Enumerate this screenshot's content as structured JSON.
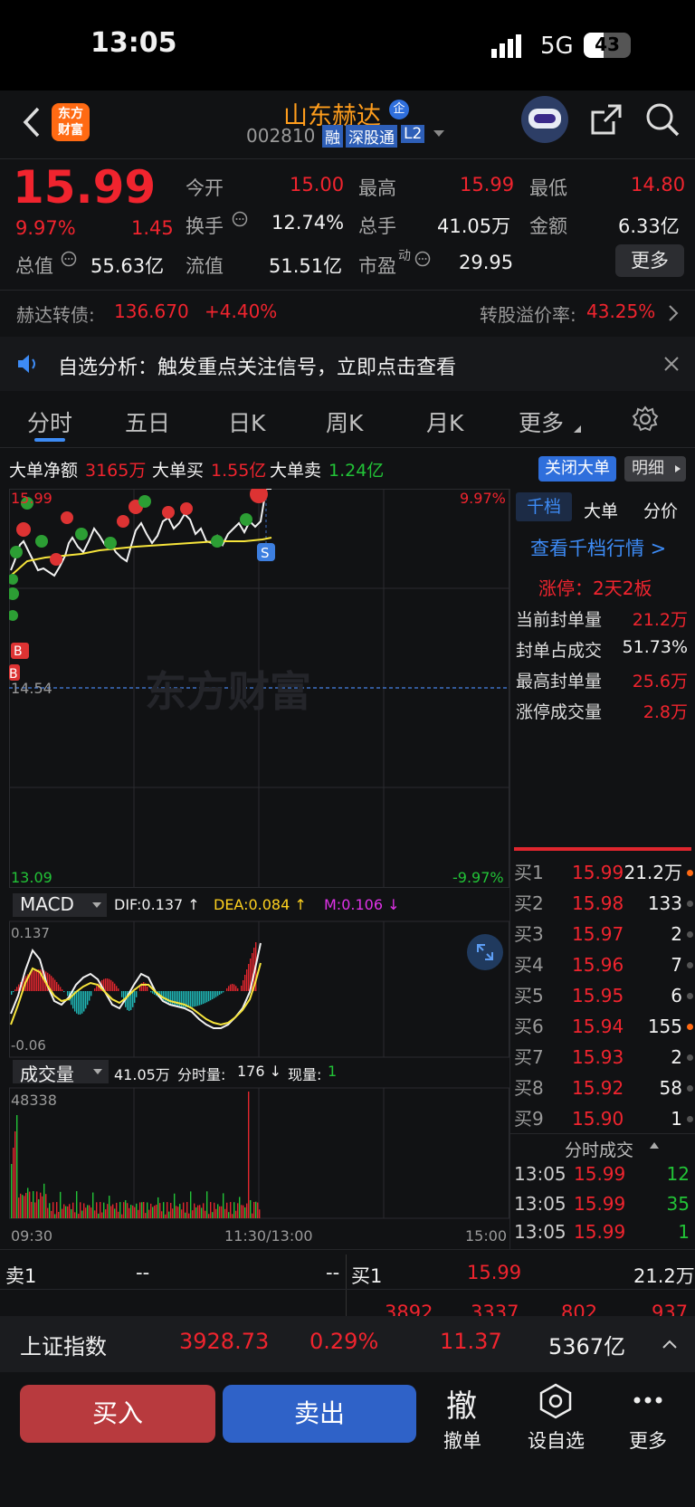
{
  "status_bar": {
    "time": "13:05",
    "network": "5G",
    "battery": "43"
  },
  "header": {
    "logo_text_1": "东方",
    "logo_text_2": "财富",
    "stock_name": "山东赫达",
    "stock_code": "002810",
    "tags": [
      "融",
      "深股通",
      "L2"
    ],
    "badge": "企"
  },
  "quote": {
    "price": "15.99",
    "change_pct": "9.97%",
    "change": "1.45",
    "total_mkt_label": "总值",
    "total_mkt": "55.63亿",
    "open_label": "今开",
    "open": "15.00",
    "turnover_label": "换手",
    "turnover": "12.74%",
    "float_label": "流值",
    "float": "51.51亿",
    "high_label": "最高",
    "high": "15.99",
    "volume_label": "总手",
    "volume": "41.05万",
    "pe_label": "市盈",
    "pe_sup": "动",
    "pe": "29.95",
    "low_label": "最低",
    "low": "14.80",
    "amount_label": "金额",
    "amount": "6.33亿",
    "more_button": "更多"
  },
  "bond": {
    "label": "赫达转债:",
    "price": "136.670",
    "change": "+4.40%",
    "premium_label": "转股溢价率:",
    "premium": "43.25%"
  },
  "notice": {
    "text": "自选分析：触发重点关注信号，立即点击查看"
  },
  "tabs": [
    "分时",
    "五日",
    "日K",
    "周K",
    "月K",
    "更多"
  ],
  "bigorder": {
    "net_label": "大单净额",
    "net": "3165万",
    "buy_label": "大单买",
    "buy": "1.55亿",
    "sell_label": "大单卖",
    "sell": "1.24亿",
    "close_btn": "关闭大单",
    "detail_btn": "明细"
  },
  "chart": {
    "price_top": "15.99",
    "pct_top": "9.97%",
    "price_mid": "14.54",
    "price_bot": "13.09",
    "pct_bot": "-9.97%",
    "watermark": "东方财富",
    "macd_label": "MACD",
    "dif": "DIF:0.137 ↑",
    "dea": "DEA:0.084 ↑",
    "m": "M:0.106 ↓",
    "macd_top": "0.137",
    "macd_bot": "-0.06",
    "vol_label": "成交量",
    "vol_total": "41.05万",
    "vol_min_label": "分时量:",
    "vol_min": "176 ↓",
    "vol_now_label": "现量:",
    "vol_now": "1",
    "vol_max": "48338",
    "time_start": "09:30",
    "time_mid": "11:30/13:00",
    "time_end": "15:00",
    "marker_b": "B",
    "marker_s": "S"
  },
  "side": {
    "tabs": [
      "千档",
      "大单",
      "分价"
    ],
    "qiandang_link": "查看千档行情 >",
    "limit_text": "涨停：2天2板",
    "stats": [
      {
        "label": "当前封单量",
        "value": "21.2万"
      },
      {
        "label": "封单占成交",
        "value": "51.73%"
      },
      {
        "label": "最高封单量",
        "value": "25.6万"
      },
      {
        "label": "涨停成交量",
        "value": "2.8万"
      }
    ],
    "bids": [
      {
        "label": "买1",
        "price": "15.99",
        "vol": "21.2万"
      },
      {
        "label": "买2",
        "price": "15.98",
        "vol": "133"
      },
      {
        "label": "买3",
        "price": "15.97",
        "vol": "2"
      },
      {
        "label": "买4",
        "price": "15.96",
        "vol": "7"
      },
      {
        "label": "买5",
        "price": "15.95",
        "vol": "6"
      },
      {
        "label": "买6",
        "price": "15.94",
        "vol": "155"
      },
      {
        "label": "买7",
        "price": "15.93",
        "vol": "2"
      },
      {
        "label": "买8",
        "price": "15.92",
        "vol": "58"
      },
      {
        "label": "买9",
        "price": "15.90",
        "vol": "1"
      }
    ],
    "ticks_title": "分时成交",
    "ticks": [
      {
        "time": "13:05",
        "price": "15.99",
        "vol": "12"
      },
      {
        "time": "13:05",
        "price": "15.99",
        "vol": "35"
      },
      {
        "time": "13:05",
        "price": "15.99",
        "vol": "1"
      }
    ]
  },
  "book_row": {
    "sell_label": "卖1",
    "sell_price": "--",
    "sell_vol": "--",
    "buy_label": "买1",
    "buy_price": "15.99",
    "buy_vol": "21.2万",
    "partial": [
      "3892",
      "3337",
      "802",
      "937"
    ]
  },
  "index_bar": {
    "name": "上证指数",
    "value": "3928.73",
    "pct": "0.29%",
    "change": "11.37",
    "amount": "5367亿"
  },
  "bottom": {
    "buy": "买入",
    "sell": "卖出",
    "cancel_icon": "撤",
    "cancel": "撤单",
    "watch": "设自选",
    "more": "更多"
  }
}
